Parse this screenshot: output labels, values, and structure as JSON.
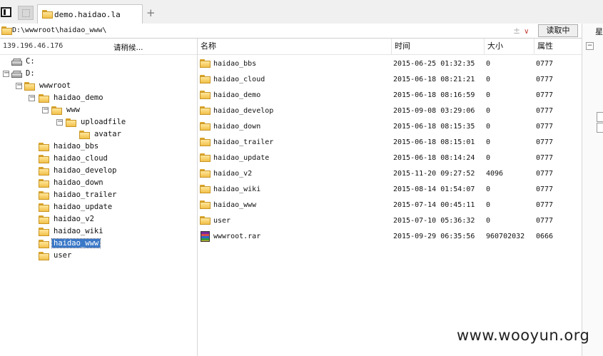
{
  "tab": {
    "title": "demo.haidao.la",
    "new_tab": "+"
  },
  "address": {
    "path": "D:\\wwwroot\\haidao_www\\",
    "read_button": "读取中",
    "icons": [
      "pin-icon",
      "chevron-down-icon"
    ]
  },
  "right_strip": {
    "label": "星"
  },
  "left_header": {
    "ip": "139.196.46.176",
    "status": "请稍候..."
  },
  "tree": [
    {
      "label": "C:",
      "type": "drive"
    },
    {
      "label": "D:",
      "type": "drive",
      "expanded": true
    },
    {
      "label": "wwwroot",
      "type": "folder",
      "expanded": true
    },
    {
      "label": "haidao_demo",
      "type": "folder",
      "expanded": true
    },
    {
      "label": "www",
      "type": "folder",
      "expanded": true
    },
    {
      "label": "uploadfile",
      "type": "folder",
      "expanded": true
    },
    {
      "label": "avatar",
      "type": "folder"
    },
    {
      "label": "haidao_bbs",
      "type": "folder"
    },
    {
      "label": "haidao_cloud",
      "type": "folder"
    },
    {
      "label": "haidao_develop",
      "type": "folder"
    },
    {
      "label": "haidao_down",
      "type": "folder"
    },
    {
      "label": "haidao_trailer",
      "type": "folder"
    },
    {
      "label": "haidao_update",
      "type": "folder"
    },
    {
      "label": "haidao_v2",
      "type": "folder"
    },
    {
      "label": "haidao_wiki",
      "type": "folder"
    },
    {
      "label": "haidao_www",
      "type": "folder",
      "selected": true
    },
    {
      "label": "user",
      "type": "folder"
    }
  ],
  "columns": {
    "name": "名称",
    "time": "时间",
    "size": "大小",
    "attr": "属性"
  },
  "files": [
    {
      "name": "haidao_bbs",
      "time": "2015-06-25 01:32:35",
      "size": "0",
      "attr": "0777",
      "type": "folder"
    },
    {
      "name": "haidao_cloud",
      "time": "2015-06-18 08:21:21",
      "size": "0",
      "attr": "0777",
      "type": "folder"
    },
    {
      "name": "haidao_demo",
      "time": "2015-06-18 08:16:59",
      "size": "0",
      "attr": "0777",
      "type": "folder"
    },
    {
      "name": "haidao_develop",
      "time": "2015-09-08 03:29:06",
      "size": "0",
      "attr": "0777",
      "type": "folder"
    },
    {
      "name": "haidao_down",
      "time": "2015-06-18 08:15:35",
      "size": "0",
      "attr": "0777",
      "type": "folder"
    },
    {
      "name": "haidao_trailer",
      "time": "2015-06-18 08:15:01",
      "size": "0",
      "attr": "0777",
      "type": "folder"
    },
    {
      "name": "haidao_update",
      "time": "2015-06-18 08:14:24",
      "size": "0",
      "attr": "0777",
      "type": "folder"
    },
    {
      "name": "haidao_v2",
      "time": "2015-11-20 09:27:52",
      "size": "4096",
      "attr": "0777",
      "type": "folder"
    },
    {
      "name": "haidao_wiki",
      "time": "2015-08-14 01:54:07",
      "size": "0",
      "attr": "0777",
      "type": "folder"
    },
    {
      "name": "haidao_www",
      "time": "2015-07-14 00:45:11",
      "size": "0",
      "attr": "0777",
      "type": "folder"
    },
    {
      "name": "user",
      "time": "2015-07-10 05:36:32",
      "size": "0",
      "attr": "0777",
      "type": "folder"
    },
    {
      "name": "wwwroot.rar",
      "time": "2015-09-29 06:35:56",
      "size": "960702032",
      "attr": "0666",
      "type": "archive"
    }
  ],
  "watermark": "www.wooyun.org"
}
